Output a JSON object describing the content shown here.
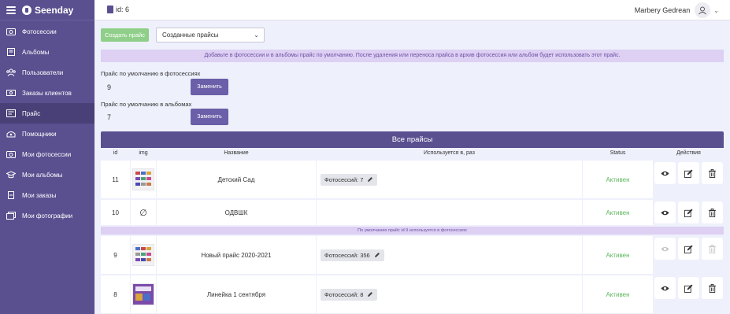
{
  "app": {
    "brand": "Seenday"
  },
  "sidebar": {
    "items": [
      {
        "label": "Фотосессии",
        "icon": "camera-icon"
      },
      {
        "label": "Альбомы",
        "icon": "book-icon"
      },
      {
        "label": "Пользователи",
        "icon": "users-icon"
      },
      {
        "label": "Заказы клиентов",
        "icon": "money-icon"
      },
      {
        "label": "Прайс",
        "icon": "price-icon"
      },
      {
        "label": "Помощники",
        "icon": "helper-icon"
      },
      {
        "label": "Мои фотосессии",
        "icon": "camera-icon"
      },
      {
        "label": "Мои альбомы",
        "icon": "graduation-icon"
      },
      {
        "label": "Мои заказы",
        "icon": "orders-icon"
      },
      {
        "label": "Мои фотографии",
        "icon": "photos-icon"
      }
    ]
  },
  "header": {
    "id_label": "id: 6",
    "user_name": "Marbery Gedrean"
  },
  "toolbar": {
    "create_label": "Создать прайс",
    "select_value": "Созданные прайсы"
  },
  "notice": "Добавьте в фотосессии и в альбомы прайс по умолчанию. После удаления или переноса прайса в архив фотосессия или альбом будет использовать этот прайс.",
  "defaults": {
    "sessions_label": "Прайс по умолчанию в фотосессиях",
    "sessions_value": "9",
    "albums_label": "Прайс по умолчанию в альбомах",
    "albums_value": "7",
    "replace_label": "Заменить"
  },
  "table": {
    "title": "Все прайсы",
    "columns": [
      "id",
      "img",
      "Название",
      "Используется в, раз",
      "Status",
      "Действия"
    ],
    "rows": [
      {
        "id": "11",
        "name": "Детский Сад",
        "usage": "Фотосессий: 7",
        "status": "Активен"
      },
      {
        "id": "10",
        "name": "ОДВШК",
        "usage": "",
        "status": "Активен"
      },
      {
        "id": "9",
        "name": "Новый прайс 2020-2021",
        "usage": "Фотосессий: 356",
        "status": "Активен"
      },
      {
        "id": "8",
        "name": "Линейка 1 сентября",
        "usage": "Фотосессий: 8",
        "status": "Активен"
      }
    ],
    "subnote": "По умолчанию прайс id 9 используется в фотосессиях",
    "no_image_glyph": "∅"
  }
}
